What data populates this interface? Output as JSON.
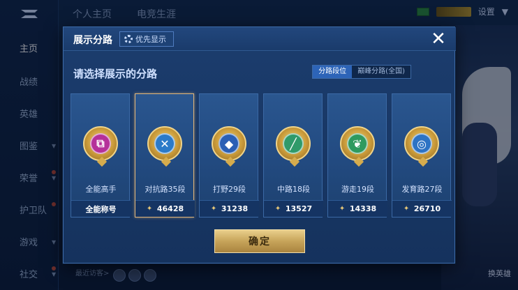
{
  "background": {
    "top_tabs": [
      "个人主页",
      "电竞生涯"
    ],
    "settings_label": "设置",
    "rail_items": [
      {
        "label": "主页",
        "active": true
      },
      {
        "label": "战绩"
      },
      {
        "label": "英雄"
      },
      {
        "label": "图鉴"
      },
      {
        "label": "荣誉"
      },
      {
        "label": "护卫队"
      },
      {
        "label": "游戏"
      },
      {
        "label": "社交"
      }
    ],
    "recent_visitors_label": "最近访客>",
    "switch_hero_label": "换英雄"
  },
  "modal": {
    "title": "展示分路",
    "priority_label": "优先显示",
    "subtitle": "请选择展示的分路",
    "segment_tabs": [
      {
        "label": "分路段位",
        "active": true
      },
      {
        "label": "巅峰分路(全国)",
        "active": false
      }
    ],
    "cards": [
      {
        "label": "全能高手",
        "footer": "全能称号",
        "has_score": false,
        "emblem_color": "#b5309a",
        "emblem_icon": "overlap-square-icon"
      },
      {
        "label": "对抗路35段",
        "score": "46428",
        "has_score": true,
        "selected": true,
        "emblem_color": "#2b7ac9",
        "emblem_icon": "crossed-swords-icon"
      },
      {
        "label": "打野29段",
        "score": "31238",
        "has_score": true,
        "emblem_color": "#2a5fb5",
        "emblem_icon": "wolf-icon"
      },
      {
        "label": "中路18段",
        "score": "13527",
        "has_score": true,
        "emblem_color": "#2f9a6a",
        "emblem_icon": "wand-icon"
      },
      {
        "label": "游走19段",
        "score": "14338",
        "has_score": true,
        "emblem_color": "#2e9a5f",
        "emblem_icon": "leaf-icon"
      },
      {
        "label": "发育路27段",
        "score": "26710",
        "has_score": true,
        "emblem_color": "#2d73c4",
        "emblem_icon": "target-icon"
      }
    ],
    "confirm_label": "确定"
  }
}
